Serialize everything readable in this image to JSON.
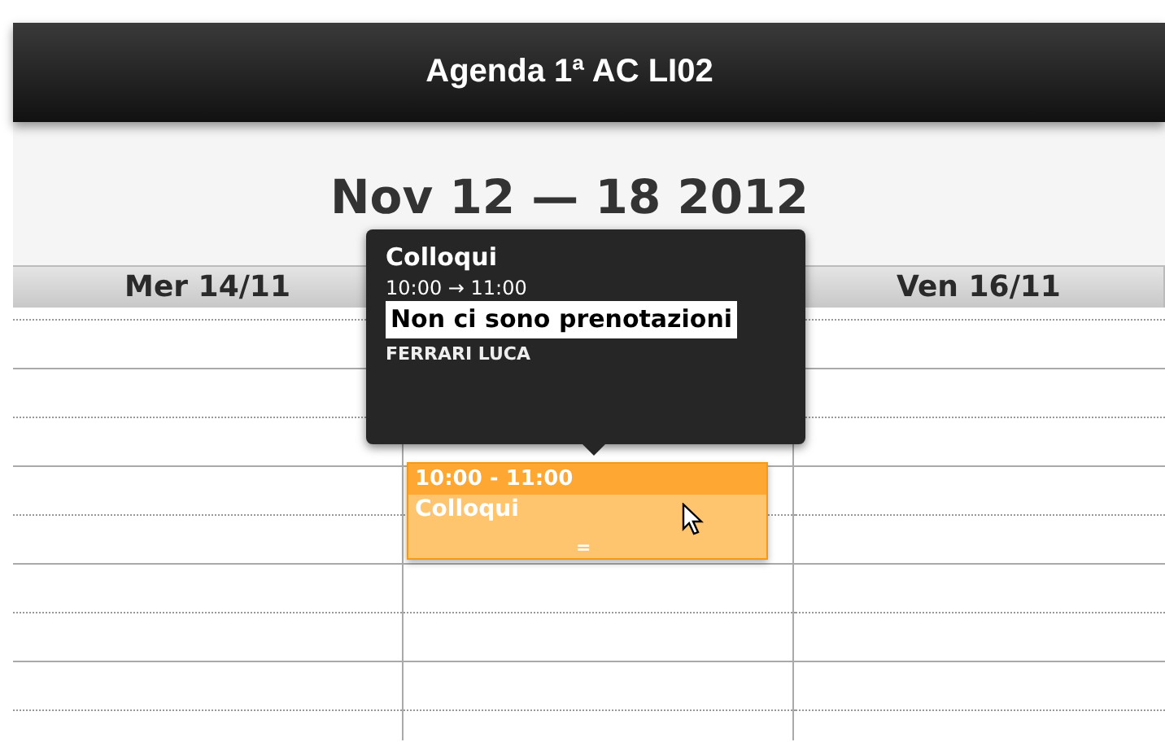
{
  "header": {
    "title": "Agenda 1ª AC LI02"
  },
  "week": {
    "title": "Nov 12 — 18 2012"
  },
  "days": [
    {
      "label": "Mer 14/11"
    },
    {
      "label": "Ven 16/11"
    }
  ],
  "event": {
    "time": "10:00 - 11:00",
    "title": "Colloqui",
    "handle": "="
  },
  "tooltip": {
    "title": "Colloqui",
    "time": "10:00 → 11:00",
    "note": "Non ci sono prenotazioni",
    "person": "FERRARI LUCA"
  }
}
